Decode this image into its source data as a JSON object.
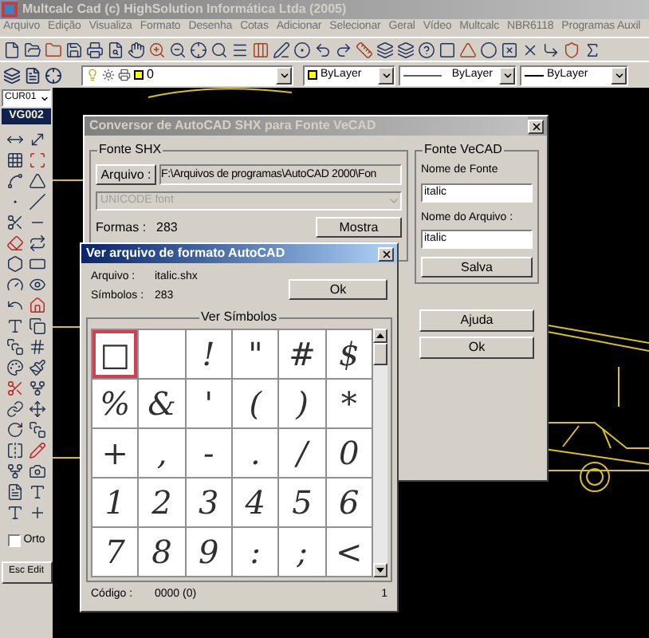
{
  "window": {
    "title": "Multcalc Cad (c) HighSolution Informática Ltda (2005)",
    "active": false
  },
  "menu": [
    "Arquivo",
    "Edição",
    "Visualiza",
    "Formato",
    "Desenha",
    "Cotas",
    "Adicionar",
    "Selecionar",
    "Geral",
    "Vídeo",
    "Multcalc",
    "NBR6118",
    "Programas Auxil"
  ],
  "layer_bar": {
    "layer": "0",
    "color_setting": "ByLayer",
    "linetype": "ByLayer",
    "lineweight": "ByLayer"
  },
  "side_toolbar": {
    "style_select": "CUR01",
    "label": "VG002",
    "ortho": {
      "label": "Orto",
      "checked": false
    },
    "button": "Esc Edit"
  },
  "converter_dialog": {
    "title": "Conversor de AutoCAD SHX para Fonte VeCAD",
    "active": false,
    "shx_group": {
      "title": "Fonte SHX",
      "file_button": "Arquivo :",
      "path": "F:\\Arquivos de programas\\AutoCAD 2000\\Fon",
      "font_select": {
        "value": "UNICODE font",
        "disabled": true
      },
      "shapes_label": "Formas :",
      "shapes_count": "283",
      "show_button": "Mostra"
    },
    "vecad_group": {
      "title": "Fonte VeCAD",
      "font_name_label": "Nome de Fonte",
      "font_name": "italic",
      "file_name_label": "Nome do Arquivo :",
      "file_name": "italic",
      "save_button": "Salva"
    },
    "help_button": "Ajuda",
    "ok_button": "Ok"
  },
  "viewer_dialog": {
    "title": "Ver arquivo de formato AutoCAD",
    "active": true,
    "file_label": "Arquivo :",
    "file": "italic.shx",
    "symbols_label": "Símbolos :",
    "symbols_count": "283",
    "ok_button": "Ok",
    "group_title": "Ver Símbolos",
    "symbols": [
      {
        "glyph": "□",
        "selected": true
      },
      {
        "selected": false
      },
      {
        "glyph": "!",
        "selected": false
      },
      {
        "glyph": "\"",
        "selected": false
      },
      {
        "glyph": "#",
        "selected": false
      },
      {
        "glyph": "$",
        "selected": false
      },
      {
        "glyph": "%",
        "selected": false
      },
      {
        "glyph": "&",
        "selected": false
      },
      {
        "glyph": "'",
        "selected": false
      },
      {
        "glyph": "(",
        "selected": false
      },
      {
        "glyph": ")",
        "selected": false
      },
      {
        "glyph": "*",
        "selected": false
      },
      {
        "glyph": "+",
        "selected": false
      },
      {
        "glyph": ",",
        "selected": false
      },
      {
        "glyph": "-",
        "selected": false
      },
      {
        "glyph": ".",
        "selected": false
      },
      {
        "glyph": "/",
        "selected": false
      },
      {
        "glyph": "0",
        "selected": false
      },
      {
        "glyph": "1",
        "selected": false
      },
      {
        "glyph": "2",
        "selected": false
      },
      {
        "glyph": "3",
        "selected": false
      },
      {
        "glyph": "4",
        "selected": false
      },
      {
        "glyph": "5",
        "selected": false
      },
      {
        "glyph": "6",
        "selected": false
      },
      {
        "glyph": "7",
        "selected": false
      },
      {
        "glyph": "8",
        "selected": false
      },
      {
        "glyph": "9",
        "selected": false
      },
      {
        "glyph": ":",
        "selected": false
      },
      {
        "glyph": ";",
        "selected": false
      },
      {
        "glyph": "<",
        "selected": false
      }
    ],
    "code_label": "Código :",
    "code": "0000 (0)",
    "page": "1"
  }
}
